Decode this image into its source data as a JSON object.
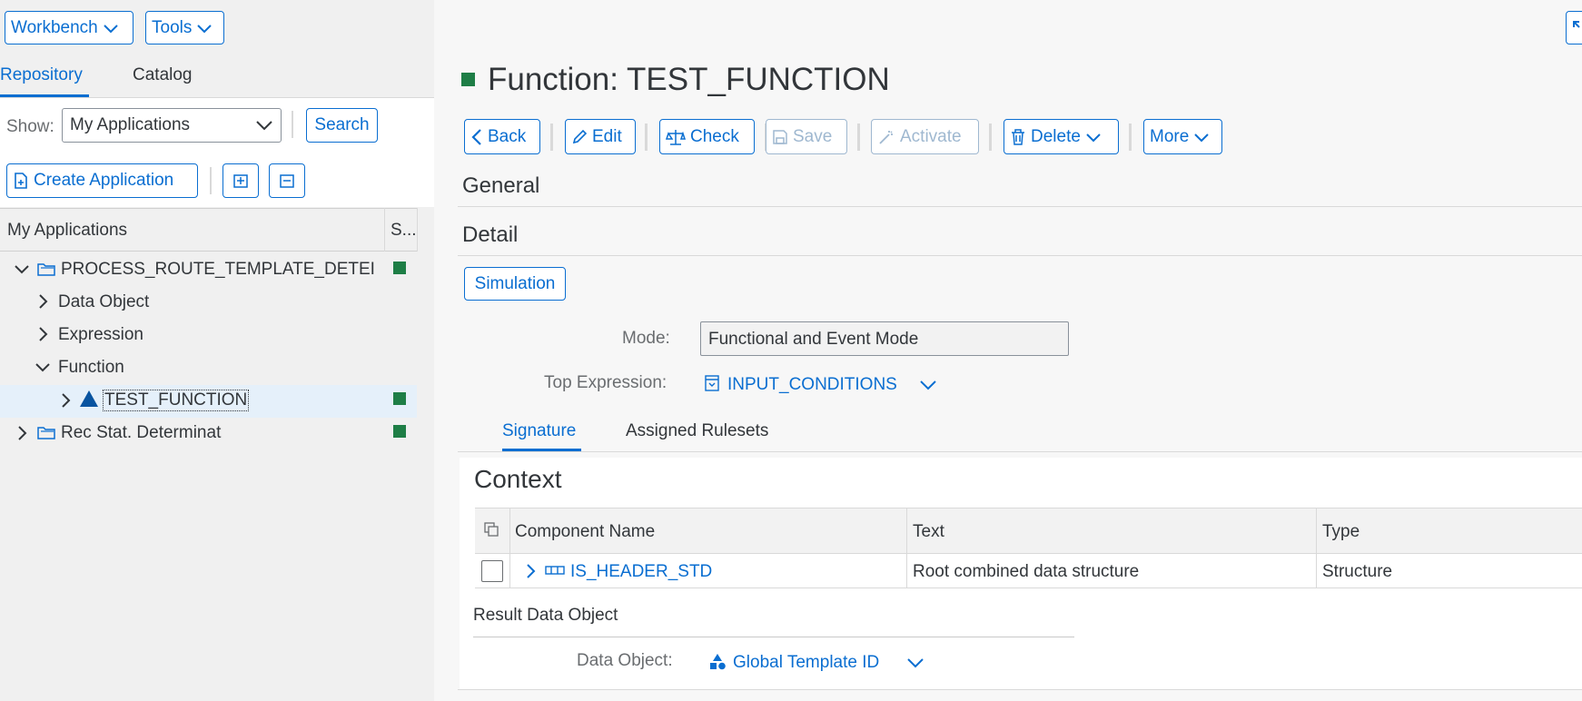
{
  "toolbar_top": {
    "workbench_label": "Workbench",
    "tools_label": "Tools"
  },
  "left": {
    "tabs": [
      {
        "label": "Repository",
        "active": true
      },
      {
        "label": "Catalog",
        "active": false
      }
    ],
    "show_label": "Show:",
    "show_value": "My Applications",
    "search_label": "Search",
    "create_label": "Create Application",
    "tree_header": {
      "col1": "My Applications",
      "col2": "S..."
    },
    "tree": [
      {
        "label": "PROCESS_ROUTE_TEMPLATE_DETEI",
        "status": true
      },
      {
        "label": "Data Object"
      },
      {
        "label": "Expression"
      },
      {
        "label": "Function"
      },
      {
        "label": "TEST_FUNCTION",
        "status": true
      },
      {
        "label": "Rec Stat. Determinat",
        "status": true
      }
    ]
  },
  "main": {
    "title": "Function: TEST_FUNCTION",
    "status_color": "#1e7e46",
    "toolbar": {
      "back": "Back",
      "edit": "Edit",
      "check": "Check",
      "save": "Save",
      "activate": "Activate",
      "delete": "Delete",
      "more": "More"
    },
    "sections": {
      "general": "General",
      "detail": "Detail"
    },
    "simulation_label": "Simulation",
    "mode_label": "Mode:",
    "mode_value": "Functional and Event Mode",
    "top_expr_label": "Top Expression:",
    "top_expr_value": "INPUT_CONDITIONS",
    "tabs": [
      {
        "label": "Signature",
        "active": true
      },
      {
        "label": "Assigned Rulesets",
        "active": false
      }
    ],
    "context_title": "Context",
    "table": {
      "headers": [
        "Component Name",
        "Text",
        "Type"
      ],
      "rows": [
        {
          "name": "IS_HEADER_STD",
          "text": "Root combined data structure",
          "type": "Structure"
        }
      ]
    },
    "result_title": "Result Data Object",
    "data_object_label": "Data Object:",
    "data_object_value": "Global Template ID"
  },
  "colors": {
    "accent": "#0a6ed1",
    "status": "#1e7e46",
    "text": "#32363a"
  }
}
